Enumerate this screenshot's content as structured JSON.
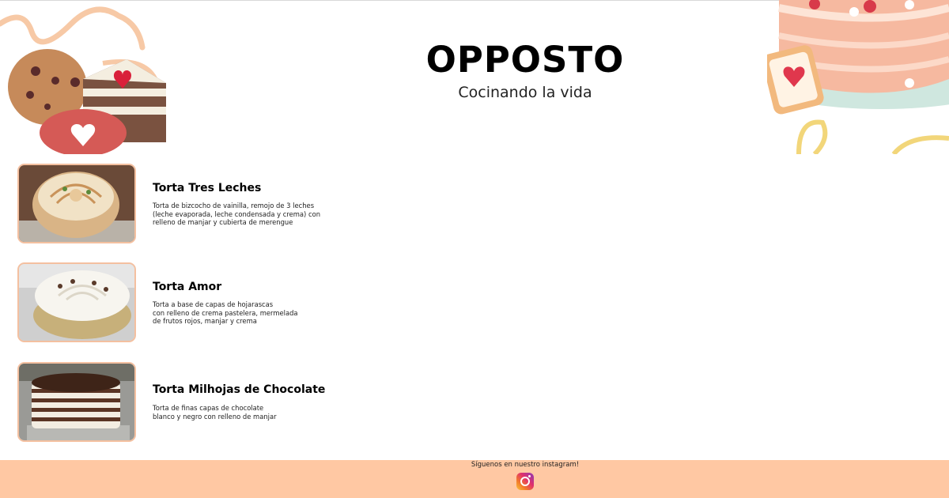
{
  "header": {
    "brand": "OPPOSTO",
    "tagline": "Cocinando la vida"
  },
  "products": [
    {
      "name": "Torta Tres Leches",
      "description": "Torta de bizcocho de vainilla, remojo de 3 leches\n(leche evaporada, leche condensada y crema) con\nrelleno de manjar y cubierta de merengue"
    },
    {
      "name": "Torta Amor",
      "description": "Torta a base de capas de hojarascas\ncon relleno de crema pastelera, mermelada\nde frutos rojos, manjar y crema"
    },
    {
      "name": "Torta Milhojas de Chocolate",
      "description": "Torta de finas capas de chocolate\nblanco y negro con relleno de manjar"
    }
  ],
  "footer": {
    "cta": "Síguenos en nuestro instagram!",
    "social_icon": "instagram-icon"
  },
  "colors": {
    "accent": "#ffc8a3",
    "thumb_border": "#f4c0a0"
  }
}
